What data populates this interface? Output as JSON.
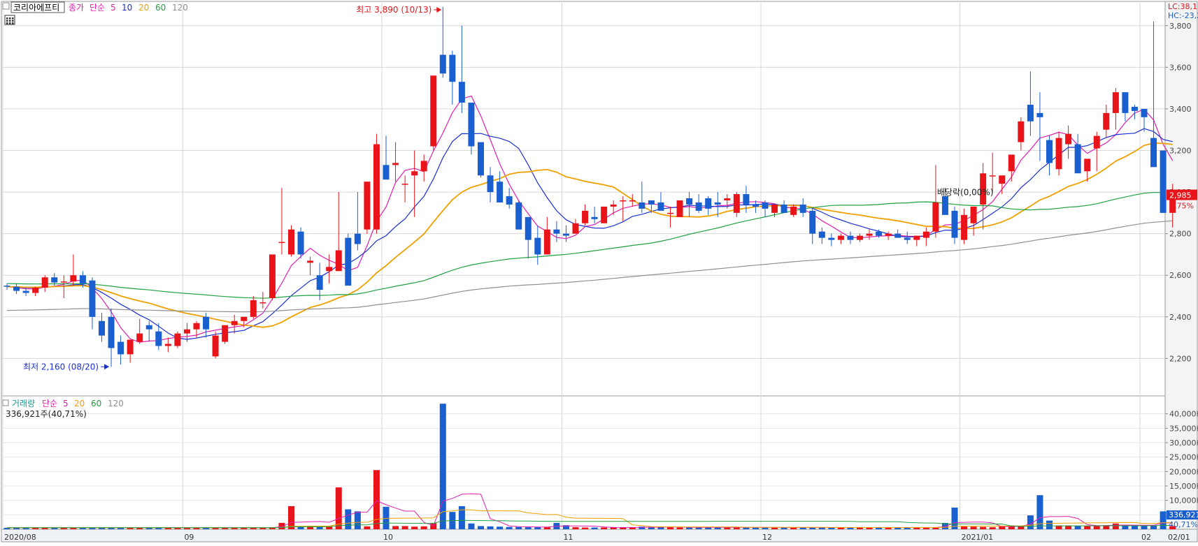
{
  "chart_data": {
    "type": "candlestick",
    "stock_name": "코리아에프티",
    "price_legend": [
      "종가",
      "단순",
      "5",
      "10",
      "20",
      "60",
      "120"
    ],
    "volume_legend": [
      "거래량",
      "단순",
      "5",
      "20",
      "60",
      "120"
    ],
    "colors": {
      "up": "#e8141a",
      "down": "#1a5fd0",
      "ma5": "#e020b0",
      "ma10": "#1a2fd0",
      "ma20": "#f0a000",
      "ma60": "#20a040",
      "ma120": "#909090",
      "grid": "#d8d8d8"
    },
    "high_label": "최고 3,890 (10/13)",
    "low_label": "최저 2,160 (08/20)",
    "lc_label": "LC:38,1",
    "hc_label": "HC:-23,2",
    "last_price_label": "2,985",
    "change_label": "2,75%",
    "volume_label": "336,921주(40,71%)",
    "volume_value_label": "336,921",
    "volume_pct_label": "40,71%",
    "marker_label": "배당락(0,00%)",
    "price_ticks": [
      2200,
      2400,
      2600,
      2800,
      3000,
      3200,
      3400,
      3600,
      3800
    ],
    "price_tick_labels": [
      "2,200",
      "2,400",
      "2,600",
      "2,800",
      "2,985",
      "3,200",
      "3,400",
      "3,600",
      "3,800"
    ],
    "price_range": [
      2020,
      3910
    ],
    "volume_ticks": [
      5000,
      10000,
      15000,
      20000,
      25000,
      30000,
      35000,
      40000
    ],
    "volume_tick_labels": [
      "5,000K",
      "10,000K",
      "15,000K",
      "20,000K",
      "25,000K",
      "30,000K",
      "35,000K",
      "40,000K"
    ],
    "volume_range": [
      0,
      45000
    ],
    "x_labels": [
      {
        "idx": 0,
        "text": "2020/08"
      },
      {
        "idx": 19,
        "text": "09"
      },
      {
        "idx": 40,
        "text": "10"
      },
      {
        "idx": 59,
        "text": "11"
      },
      {
        "idx": 80,
        "text": "12"
      },
      {
        "idx": 101,
        "text": "2021/01"
      },
      {
        "idx": 120,
        "text": "02"
      }
    ],
    "right_date_label": "02/01",
    "candles": [
      [
        2550,
        2560,
        2530,
        2545
      ],
      [
        2545,
        2560,
        2510,
        2525
      ],
      [
        2525,
        2540,
        2500,
        2515
      ],
      [
        2515,
        2545,
        2500,
        2540
      ],
      [
        2540,
        2600,
        2520,
        2590
      ],
      [
        2590,
        2610,
        2550,
        2565
      ],
      [
        2565,
        2600,
        2490,
        2570
      ],
      [
        2570,
        2700,
        2550,
        2600
      ],
      [
        2600,
        2620,
        2540,
        2560
      ],
      [
        2575,
        2590,
        2340,
        2400
      ],
      [
        2380,
        2420,
        2280,
        2310
      ],
      [
        2400,
        2440,
        2160,
        2250
      ],
      [
        2280,
        2310,
        2170,
        2220
      ],
      [
        2220,
        2290,
        2180,
        2290
      ],
      [
        2280,
        2390,
        2270,
        2320
      ],
      [
        2360,
        2380,
        2280,
        2340
      ],
      [
        2330,
        2370,
        2240,
        2260
      ],
      [
        2260,
        2300,
        2230,
        2270
      ],
      [
        2260,
        2330,
        2250,
        2320
      ],
      [
        2320,
        2370,
        2280,
        2340
      ],
      [
        2340,
        2380,
        2300,
        2370
      ],
      [
        2400,
        2420,
        2300,
        2340
      ],
      [
        2210,
        2330,
        2200,
        2310
      ],
      [
        2280,
        2360,
        2270,
        2360
      ],
      [
        2360,
        2410,
        2320,
        2380
      ],
      [
        2380,
        2400,
        2350,
        2400
      ],
      [
        2400,
        2500,
        2390,
        2480
      ],
      [
        2470,
        2520,
        2440,
        2470
      ],
      [
        2490,
        2700,
        2480,
        2700
      ],
      [
        2760,
        3020,
        2700,
        2760
      ],
      [
        2700,
        2840,
        2690,
        2820
      ],
      [
        2810,
        2830,
        2680,
        2700
      ],
      [
        2660,
        2690,
        2600,
        2670
      ],
      [
        2600,
        2660,
        2480,
        2530
      ],
      [
        2620,
        2700,
        2560,
        2640
      ],
      [
        2620,
        3000,
        2620,
        2720
      ],
      [
        2780,
        2800,
        2590,
        2550
      ],
      [
        2800,
        3000,
        2720,
        2750
      ],
      [
        2820,
        3000,
        2800,
        3050
      ],
      [
        2820,
        3280,
        2800,
        3230
      ],
      [
        3130,
        3270,
        3100,
        3060
      ],
      [
        3130,
        3240,
        3050,
        3140
      ],
      [
        3040,
        3080,
        2950,
        3040
      ],
      [
        3080,
        3200,
        2880,
        3100
      ],
      [
        3100,
        3180,
        3050,
        3150
      ],
      [
        3220,
        3500,
        3200,
        3560
      ],
      [
        3660,
        3890,
        3550,
        3570
      ],
      [
        3660,
        3680,
        3420,
        3530
      ],
      [
        3530,
        3800,
        3380,
        3430
      ],
      [
        3430,
        3380,
        3180,
        3220
      ],
      [
        3240,
        3170,
        3070,
        3080
      ],
      [
        3080,
        3120,
        2950,
        3000
      ],
      [
        3050,
        3100,
        2950,
        2950
      ],
      [
        2980,
        3020,
        2920,
        2940
      ],
      [
        2950,
        2960,
        2820,
        2820
      ],
      [
        2880,
        2880,
        2680,
        2770
      ],
      [
        2780,
        2840,
        2650,
        2700
      ],
      [
        2700,
        2880,
        2700,
        2820
      ],
      [
        2820,
        2860,
        2760,
        2800
      ],
      [
        2800,
        2840,
        2760,
        2790
      ],
      [
        2800,
        2870,
        2800,
        2850
      ],
      [
        2850,
        2940,
        2840,
        2910
      ],
      [
        2880,
        2930,
        2850,
        2870
      ],
      [
        2850,
        2930,
        2850,
        2930
      ],
      [
        2930,
        2960,
        2890,
        2940
      ],
      [
        2960,
        2980,
        2860,
        2960
      ],
      [
        2960,
        2990,
        2930,
        2960
      ],
      [
        2950,
        3050,
        2900,
        2920
      ],
      [
        2960,
        2960,
        2900,
        2940
      ],
      [
        2950,
        3000,
        2940,
        2910
      ],
      [
        2900,
        2930,
        2830,
        2900
      ],
      [
        2880,
        2960,
        2880,
        2960
      ],
      [
        2970,
        3000,
        2880,
        2940
      ],
      [
        2950,
        2990,
        2900,
        2910
      ],
      [
        2970,
        2980,
        2890,
        2920
      ],
      [
        2950,
        3000,
        2880,
        2940
      ],
      [
        2960,
        2990,
        2920,
        2970
      ],
      [
        2900,
        3000,
        2880,
        2990
      ],
      [
        2990,
        3030,
        2900,
        2940
      ],
      [
        2940,
        2960,
        2900,
        2930
      ],
      [
        2950,
        2960,
        2880,
        2920
      ],
      [
        2900,
        2940,
        2880,
        2940
      ],
      [
        2940,
        2960,
        2900,
        2900
      ],
      [
        2890,
        2940,
        2880,
        2930
      ],
      [
        2940,
        2970,
        2880,
        2900
      ],
      [
        2910,
        2920,
        2750,
        2800
      ],
      [
        2810,
        2830,
        2750,
        2780
      ],
      [
        2780,
        2800,
        2740,
        2770
      ],
      [
        2770,
        2800,
        2750,
        2790
      ],
      [
        2790,
        2810,
        2750,
        2770
      ],
      [
        2770,
        2800,
        2760,
        2790
      ],
      [
        2790,
        2820,
        2770,
        2800
      ],
      [
        2810,
        2820,
        2780,
        2790
      ],
      [
        2790,
        2810,
        2770,
        2800
      ],
      [
        2800,
        2820,
        2780,
        2780
      ],
      [
        2780,
        2810,
        2750,
        2770
      ],
      [
        2770,
        2790,
        2740,
        2790
      ],
      [
        2780,
        2830,
        2740,
        2810
      ],
      [
        2810,
        3130,
        2780,
        2950
      ],
      [
        2980,
        3020,
        2900,
        2890
      ],
      [
        2910,
        2930,
        2750,
        2780
      ],
      [
        2770,
        2920,
        2750,
        2890
      ],
      [
        2850,
        2910,
        2790,
        2930
      ],
      [
        2940,
        3140,
        2820,
        3090
      ],
      [
        3080,
        3190,
        3000,
        3080
      ],
      [
        3040,
        3060,
        2990,
        3080
      ],
      [
        3100,
        3170,
        3050,
        3180
      ],
      [
        3240,
        3360,
        3200,
        3340
      ],
      [
        3420,
        3580,
        3270,
        3340
      ],
      [
        3380,
        3480,
        3150,
        3360
      ],
      [
        3250,
        3270,
        3080,
        3140
      ],
      [
        3110,
        3290,
        3080,
        3260
      ],
      [
        3230,
        3320,
        3160,
        3280
      ],
      [
        3230,
        3280,
        3110,
        3090
      ],
      [
        3100,
        3150,
        3050,
        3160
      ],
      [
        3210,
        3290,
        3100,
        3270
      ],
      [
        3300,
        3420,
        3260,
        3380
      ],
      [
        3380,
        3500,
        3300,
        3480
      ],
      [
        3480,
        3480,
        3340,
        3380
      ],
      [
        3410,
        3420,
        3350,
        3390
      ],
      [
        3400,
        3400,
        3290,
        3360
      ],
      [
        3260,
        3820,
        3250,
        3120
      ],
      [
        3200,
        3200,
        2900,
        2900
      ],
      [
        2900,
        3040,
        2830,
        2985
      ]
    ],
    "volumes": [
      500,
      600,
      500,
      550,
      550,
      550,
      550,
      550,
      550,
      550,
      550,
      550,
      550,
      550,
      550,
      550,
      550,
      550,
      550,
      550,
      550,
      550,
      550,
      550,
      550,
      550,
      550,
      550,
      550,
      2200,
      8000,
      1000,
      1200,
      900,
      1000,
      14500,
      6900,
      6200,
      1000,
      20500,
      7800,
      1100,
      1100,
      900,
      1000,
      2100,
      43500,
      6000,
      8000,
      2000,
      1100,
      1000,
      900,
      800,
      800,
      700,
      700,
      700,
      2200,
      1400,
      700,
      600,
      600,
      600,
      600,
      600,
      600,
      900,
      800,
      700,
      700,
      600,
      600,
      600,
      600,
      700,
      600,
      700,
      600,
      600,
      600,
      600,
      600,
      600,
      600,
      600,
      600,
      600,
      600,
      600,
      600,
      600,
      600,
      600,
      600,
      600,
      600,
      600,
      600,
      2200,
      7500,
      1100,
      900,
      800,
      700,
      1100,
      1300,
      1000,
      4800,
      11800,
      3000,
      1300,
      1300,
      1200,
      1200,
      1300,
      1400,
      2000,
      1300,
      1100,
      1200,
      1300,
      6200,
      1100
    ]
  }
}
